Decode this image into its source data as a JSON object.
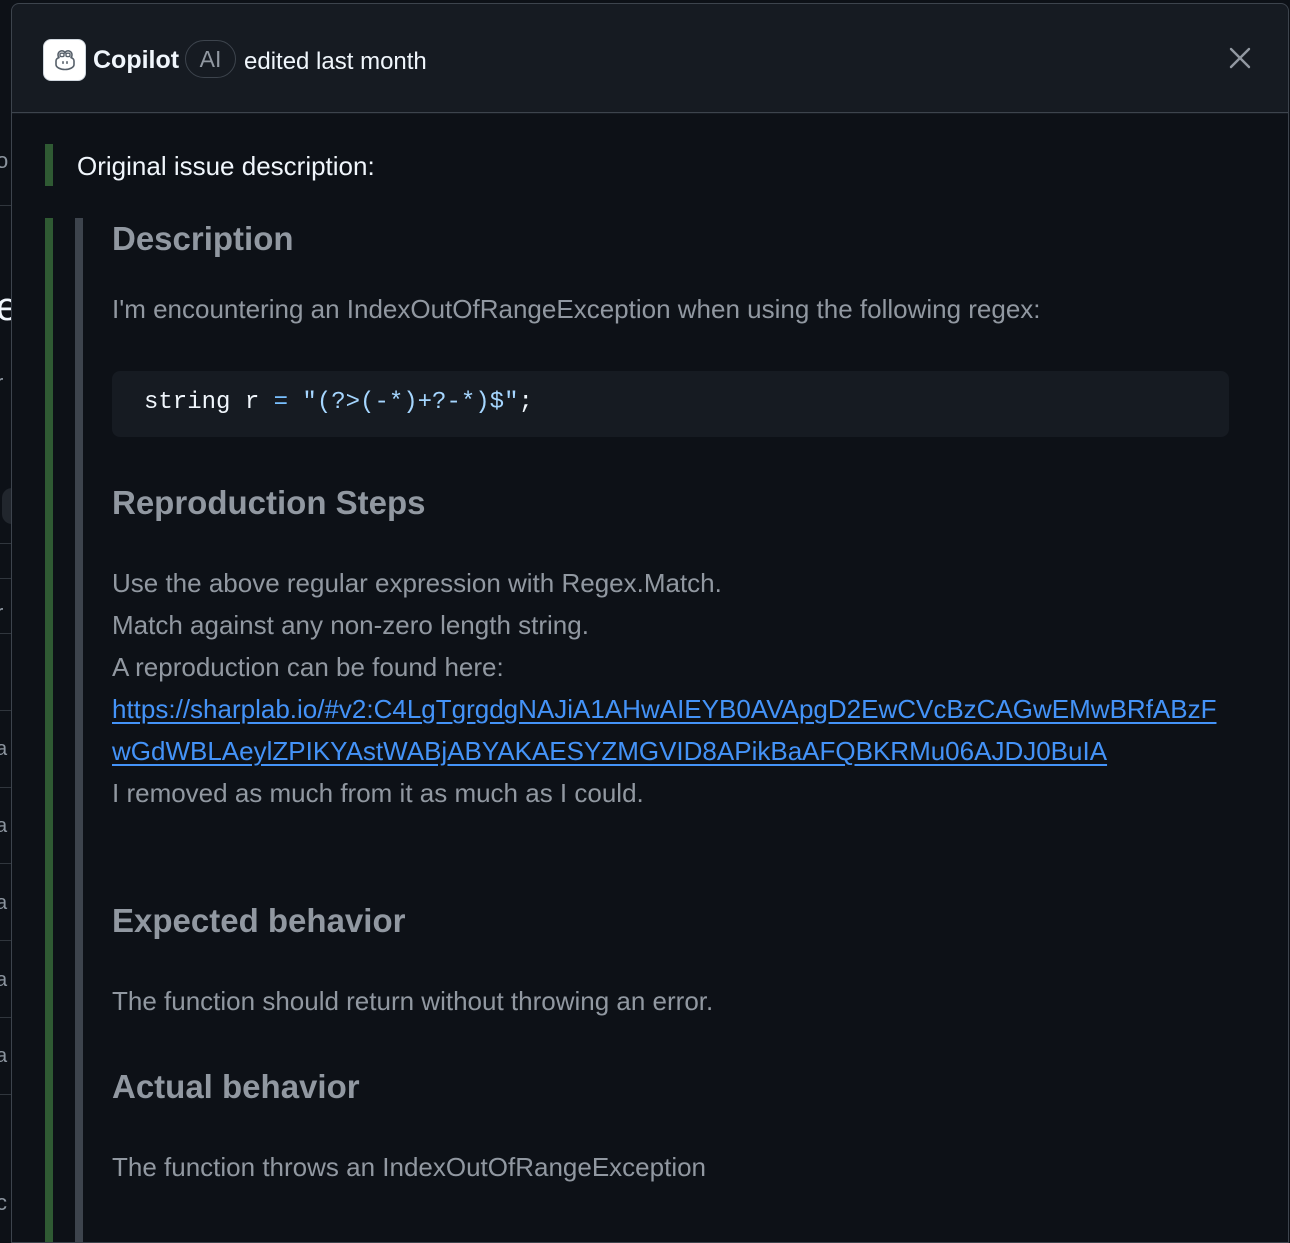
{
  "background_fragments": [
    "o",
    "e",
    "r",
    "r",
    "a",
    "a",
    "a",
    "a",
    "a",
    "c"
  ],
  "header": {
    "author": "Copilot",
    "badge": "AI",
    "edit_text": "edited last month",
    "close_label": "×"
  },
  "body": {
    "intro": "Original issue description:",
    "description_heading": "Description",
    "description_text": "I'm encountering an IndexOutOfRangeException when using the following regex:",
    "code": {
      "kw": "string r ",
      "op": "=",
      "str": " \"(?>(-*)+?-*)$\"",
      "end": ";"
    },
    "repro_heading": "Reproduction Steps",
    "repro_lines": [
      "Use the above regular expression with Regex.Match.",
      "Match against any non-zero length string.",
      "A reproduction can be found here:"
    ],
    "repro_link": "https://sharplab.io/#v2:C4LgTgrgdgNAJiA1AHwAIEYB0AVApgD2EwCVcBzCAGwEMwBRfABzFwGdWBLAeylZPIKYAstWABjABYAKAESYZMGVID8APikBaAFQBKRMu06AJDJ0BuIA",
    "repro_after": "I removed as much from it as much as I could.",
    "expected_heading": "Expected behavior",
    "expected_text": "The function should return without throwing an error.",
    "actual_heading": "Actual behavior",
    "actual_text": "The function throws an IndexOutOfRangeException"
  }
}
